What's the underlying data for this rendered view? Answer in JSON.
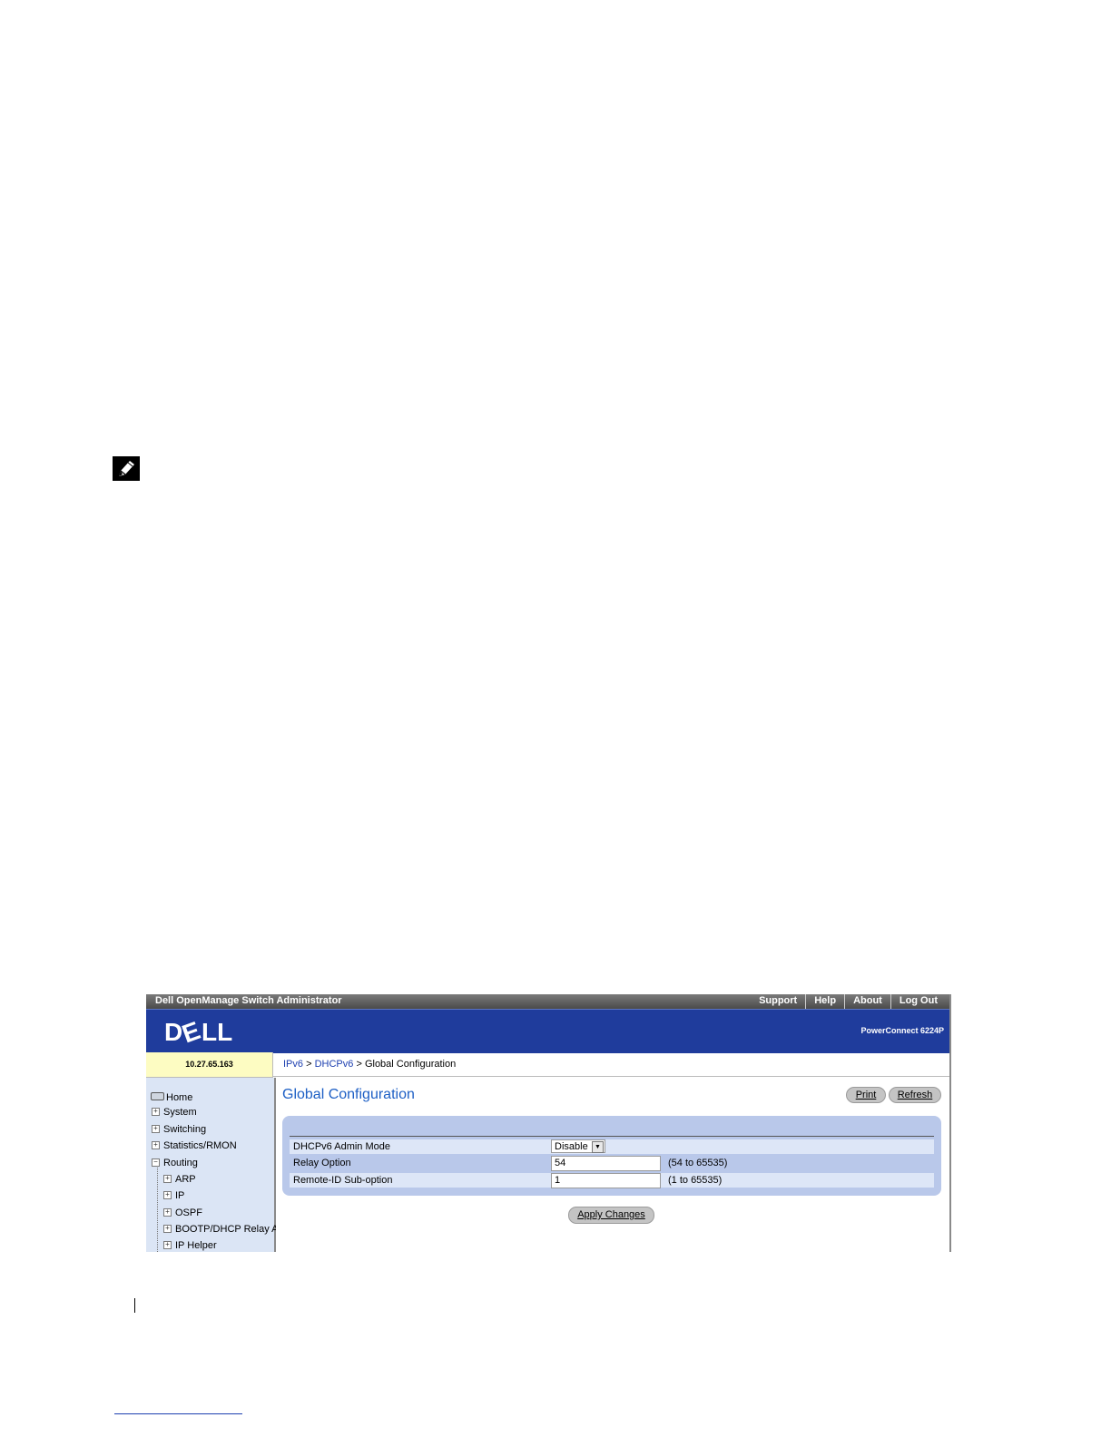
{
  "app": {
    "title": "Dell OpenManage Switch Administrator",
    "links": [
      "Support",
      "Help",
      "About",
      "Log Out"
    ],
    "model": "PowerConnect 6224P",
    "ip": "10.27.65.163"
  },
  "breadcrumb": {
    "items": [
      "IPv6",
      "DHCPv6",
      "Global Configuration"
    ],
    "separator": ">"
  },
  "sidebar": {
    "items": [
      "Home",
      "System",
      "Switching",
      "Statistics/RMON",
      "Routing",
      "ARP",
      "IP",
      "OSPF",
      "BOOTP/DHCP Relay A",
      "IP Helper"
    ]
  },
  "content": {
    "title": "Global Configuration",
    "print_label": "Print",
    "refresh_label": "Refresh",
    "rows": [
      {
        "label": "DHCPv6 Admin Mode",
        "value": "Disable",
        "range": ""
      },
      {
        "label": "Relay Option",
        "value": "54",
        "range": "(54 to 65535)"
      },
      {
        "label": "Remote-ID Sub-option",
        "value": "1",
        "range": "(1 to 65535)"
      }
    ],
    "apply_label": "Apply Changes"
  },
  "colors": {
    "banner": "#1f3c9c",
    "title": "#1d5fc5",
    "sidebar": "#dbe5f5",
    "panel": "#b9c8ea",
    "ip_cell": "#fdfcc2"
  },
  "icons": {
    "note": "pencil-note-icon"
  }
}
